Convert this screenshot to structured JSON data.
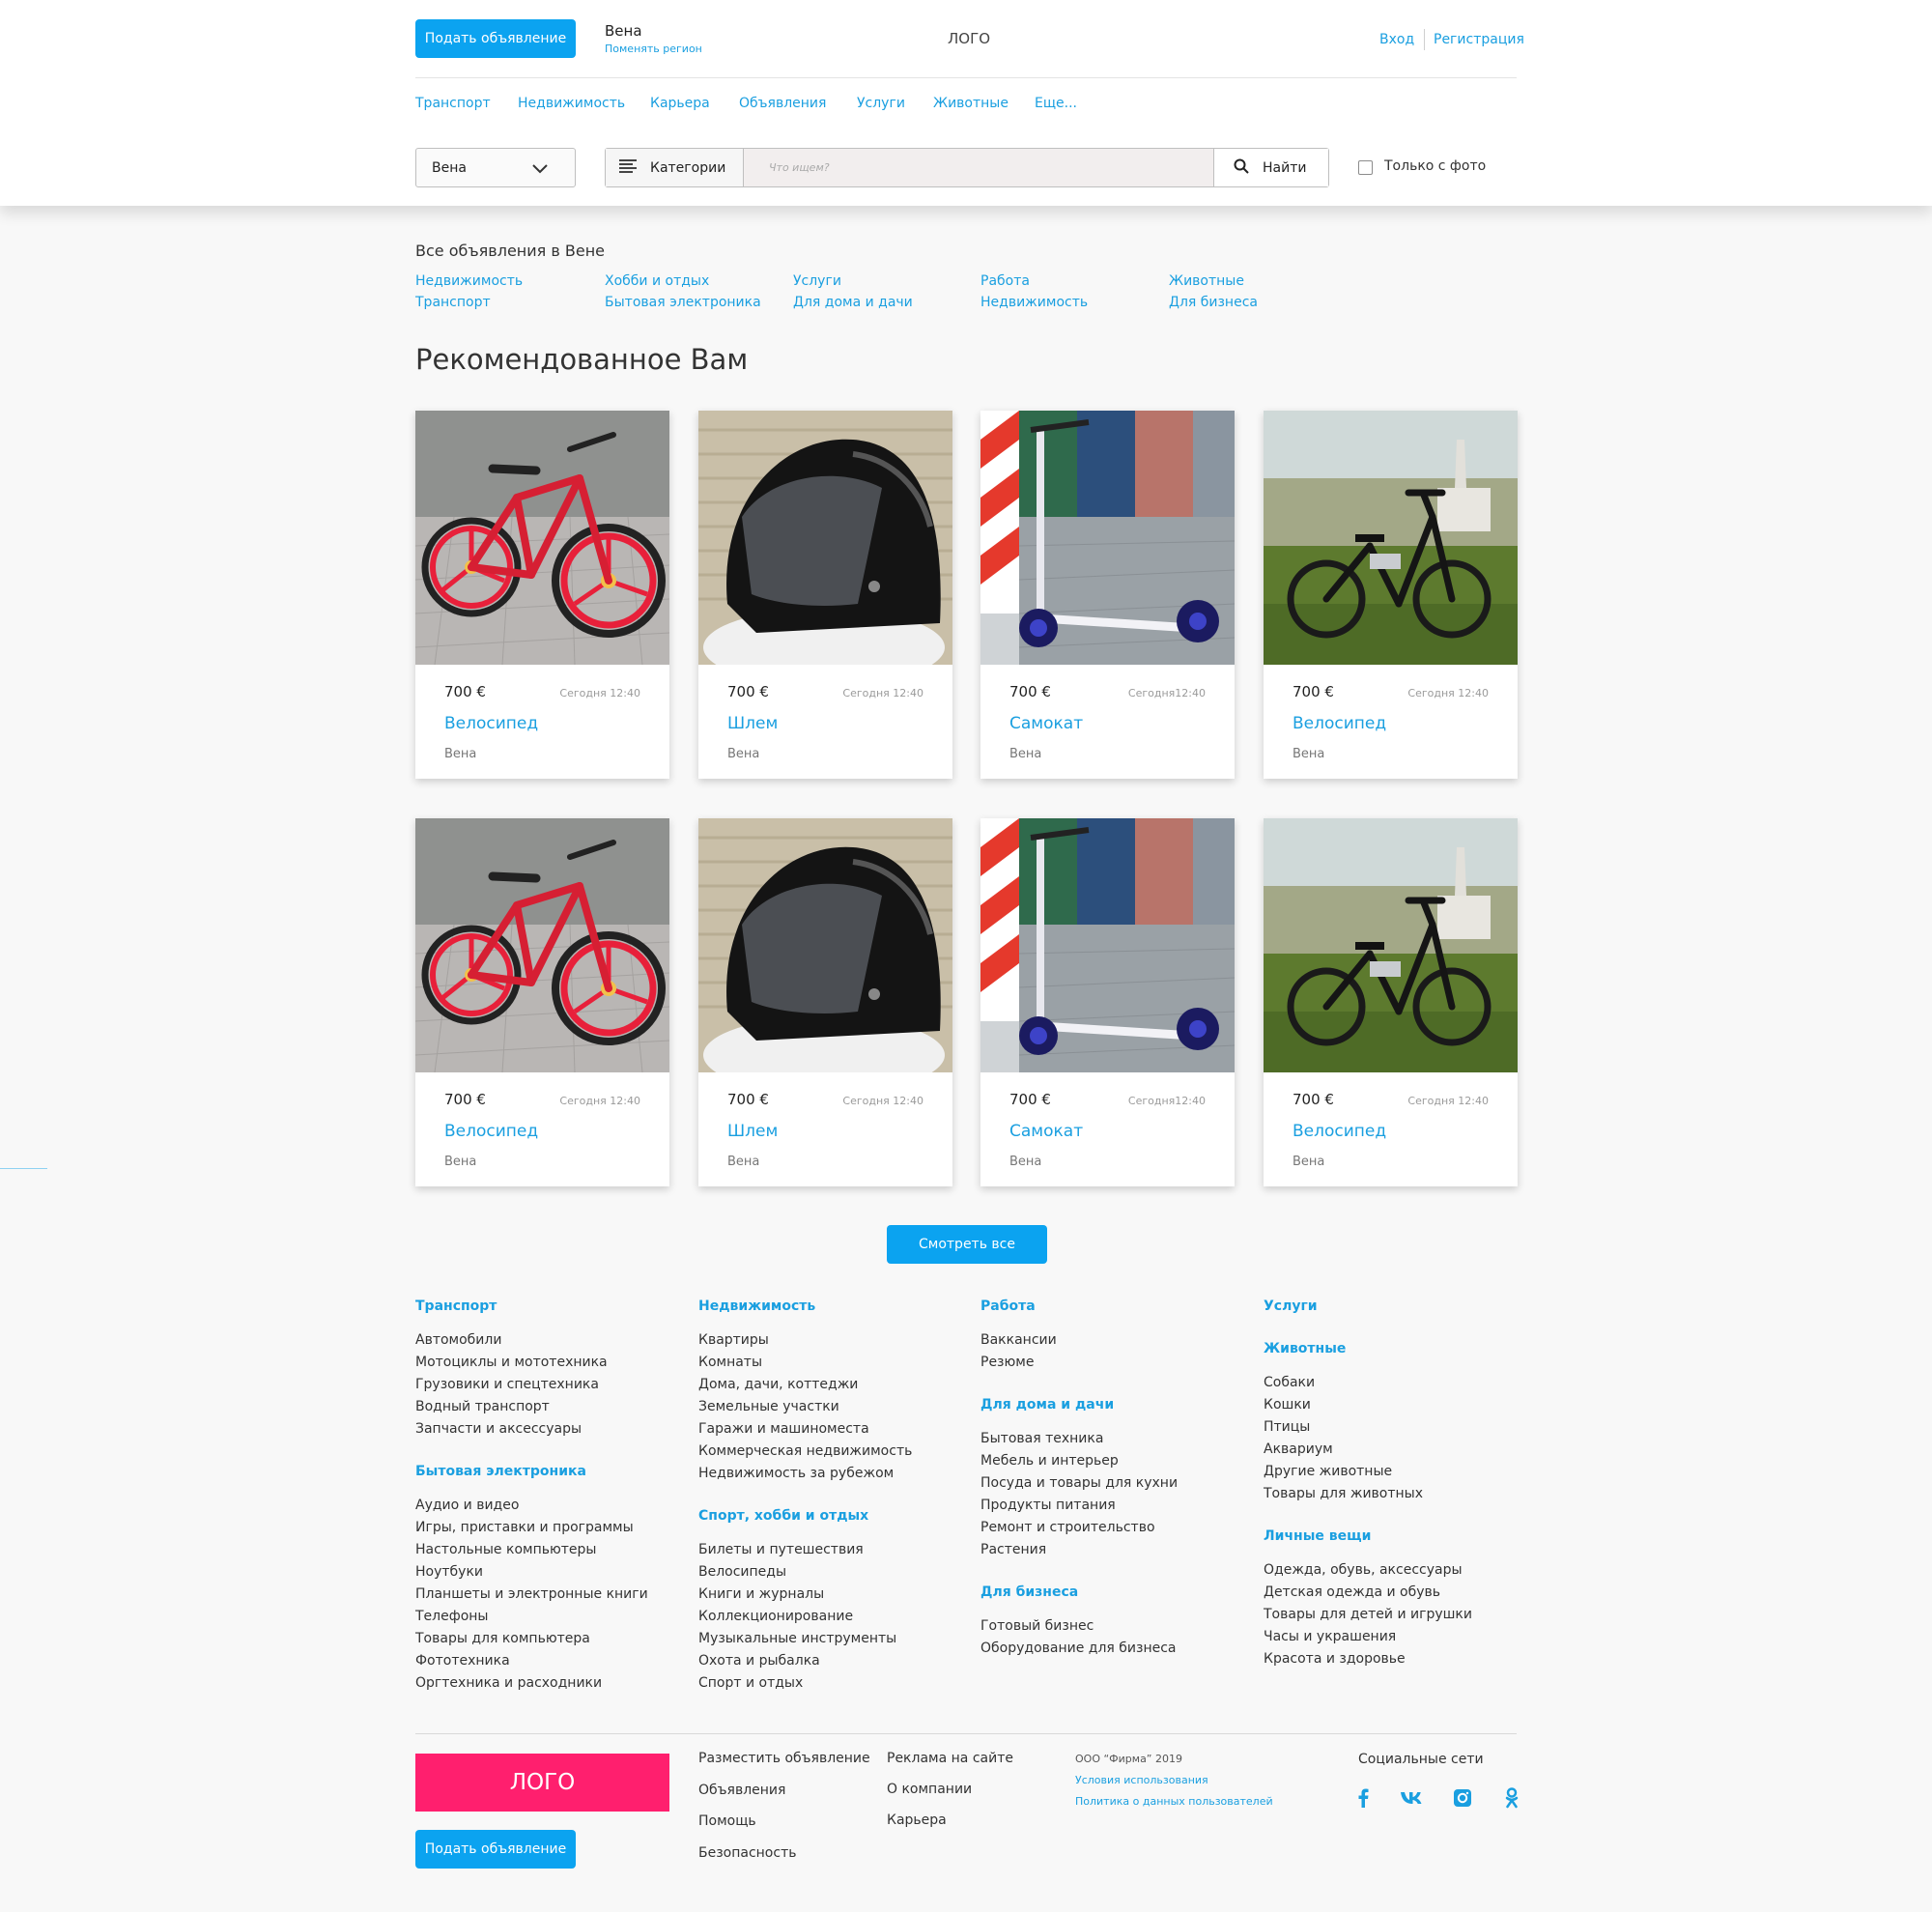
{
  "header": {
    "post_ad": "Подать объявление",
    "region": "Вена",
    "change_region": "Поменять регион",
    "logo": "ЛОГО",
    "login": "Вход",
    "register": "Регистрация",
    "nav": [
      "Транспорт",
      "Недвижимость",
      "Карьера",
      "Объявления",
      "Услуги",
      "Животные",
      "Еще..."
    ],
    "city_select": "Вена",
    "categories": "Категории",
    "search_placeholder": "Что ищем?",
    "find": "Найти",
    "only_photo": "Только с фото"
  },
  "categories": {
    "title": "Все объявления в Вене",
    "links": [
      [
        "Недвижимость",
        "Транспорт"
      ],
      [
        "Хобби и отдых",
        "Бытовая электроника"
      ],
      [
        "Услуги",
        "Для дома и дачи"
      ],
      [
        "Работа",
        "Недвижимость"
      ],
      [
        "Животные",
        "Для бизнеса"
      ]
    ]
  },
  "recommended": {
    "title": "Рекомендованное Вам",
    "cards": [
      {
        "price": "700 €",
        "date": "Сегодня 12:40",
        "title": "Велосипед",
        "city": "Вена",
        "image": "red-bicycle"
      },
      {
        "price": "700 €",
        "date": "Сегодня 12:40",
        "title": "Шлем",
        "city": "Вена",
        "image": "black-helmet"
      },
      {
        "price": "700 €",
        "date": "Сегодня12:40",
        "title": "Самокат",
        "city": "Вена",
        "image": "kick-scooter"
      },
      {
        "price": "700 €",
        "date": "Сегодня 12:40",
        "title": "Велосипед",
        "city": "Вена",
        "image": "black-e-bike"
      },
      {
        "price": "700 €",
        "date": "Сегодня 12:40",
        "title": "Велосипед",
        "city": "Вена",
        "image": "red-bicycle"
      },
      {
        "price": "700 €",
        "date": "Сегодня 12:40",
        "title": "Шлем",
        "city": "Вена",
        "image": "black-helmet"
      },
      {
        "price": "700 €",
        "date": "Сегодня12:40",
        "title": "Самокат",
        "city": "Вена",
        "image": "kick-scooter"
      },
      {
        "price": "700 €",
        "date": "Сегодня 12:40",
        "title": "Велосипед",
        "city": "Вена",
        "image": "black-e-bike"
      }
    ],
    "view_all": "Смотреть все"
  },
  "footer": {
    "columns": [
      [
        {
          "title": "Транспорт",
          "items": [
            "Автомобили",
            "Мотоциклы и мототехника",
            "Грузовики и спецтехника",
            "Водный транспорт",
            "Запчасти и аксессуары"
          ]
        },
        {
          "title": "Бытовая электроника",
          "items": [
            "Аудио и видео",
            "Игры, приставки и программы",
            "Настольные компьютеры",
            "Ноутбуки",
            "Планшеты и электронные книги",
            "Телефоны",
            "Товары для компьютера",
            "Фототехника",
            "Оргтехника и расходники"
          ]
        }
      ],
      [
        {
          "title": "Недвижимость",
          "items": [
            "Квартиры",
            "Комнаты",
            "Дома, дачи, коттеджи",
            "Земельные участки",
            "Гаражи и машиноместа",
            "Коммерческая недвижимость",
            "Недвижимость за рубежом"
          ]
        },
        {
          "title": "Спорт, хобби и отдых",
          "items": [
            "Билеты и путешествия",
            "Велосипеды",
            "Книги и журналы",
            "Коллекционирование",
            "Музыкальные инструменты",
            "Охота и рыбалка",
            "Спорт и отдых"
          ]
        }
      ],
      [
        {
          "title": "Работа",
          "items": [
            "Вакканcии",
            "Резюме"
          ]
        },
        {
          "title": "Для дома и дачи",
          "items": [
            "Бытовая техника",
            "Мебель и интерьер",
            "Посуда и товары для кухни",
            "Продукты питания",
            "Ремонт и строительство",
            "Растения"
          ]
        },
        {
          "title": "Для бизнеса",
          "items": [
            "Готовый бизнес",
            "Оборудование для бизнеса"
          ]
        }
      ],
      [
        {
          "title": "Услуги",
          "items": []
        },
        {
          "title": "Животные",
          "items": [
            "Собаки",
            "Кошки",
            "Птицы",
            "Аквариум",
            "Другие животные",
            "Товары для животных"
          ]
        },
        {
          "title": "Личные вещи",
          "items": [
            "Одежда, обувь, аксессуары",
            "Детская одежда и обувь",
            "Товары для детей и игрушки",
            "Часы и украшения",
            "Красота и здоровье"
          ]
        }
      ]
    ],
    "logo": "ЛОГО",
    "post_ad": "Подать объявление",
    "links_col1": [
      "Разместить объявление",
      "Объявления",
      "Помощь",
      "Безопасность"
    ],
    "links_col2": [
      "Реклама на сайте",
      "О компании",
      "Карьера"
    ],
    "copyright": "ООО “Фирма” 2019",
    "terms": "Условия использования",
    "privacy": "Политика о данных пользователей",
    "social_title": "Социальные сети",
    "social": [
      "facebook-icon",
      "vk-icon",
      "instagram-icon",
      "odnoklassniki-icon"
    ],
    "accent_color": "#0ba3f0",
    "logo_color": "#ff1f6e"
  }
}
